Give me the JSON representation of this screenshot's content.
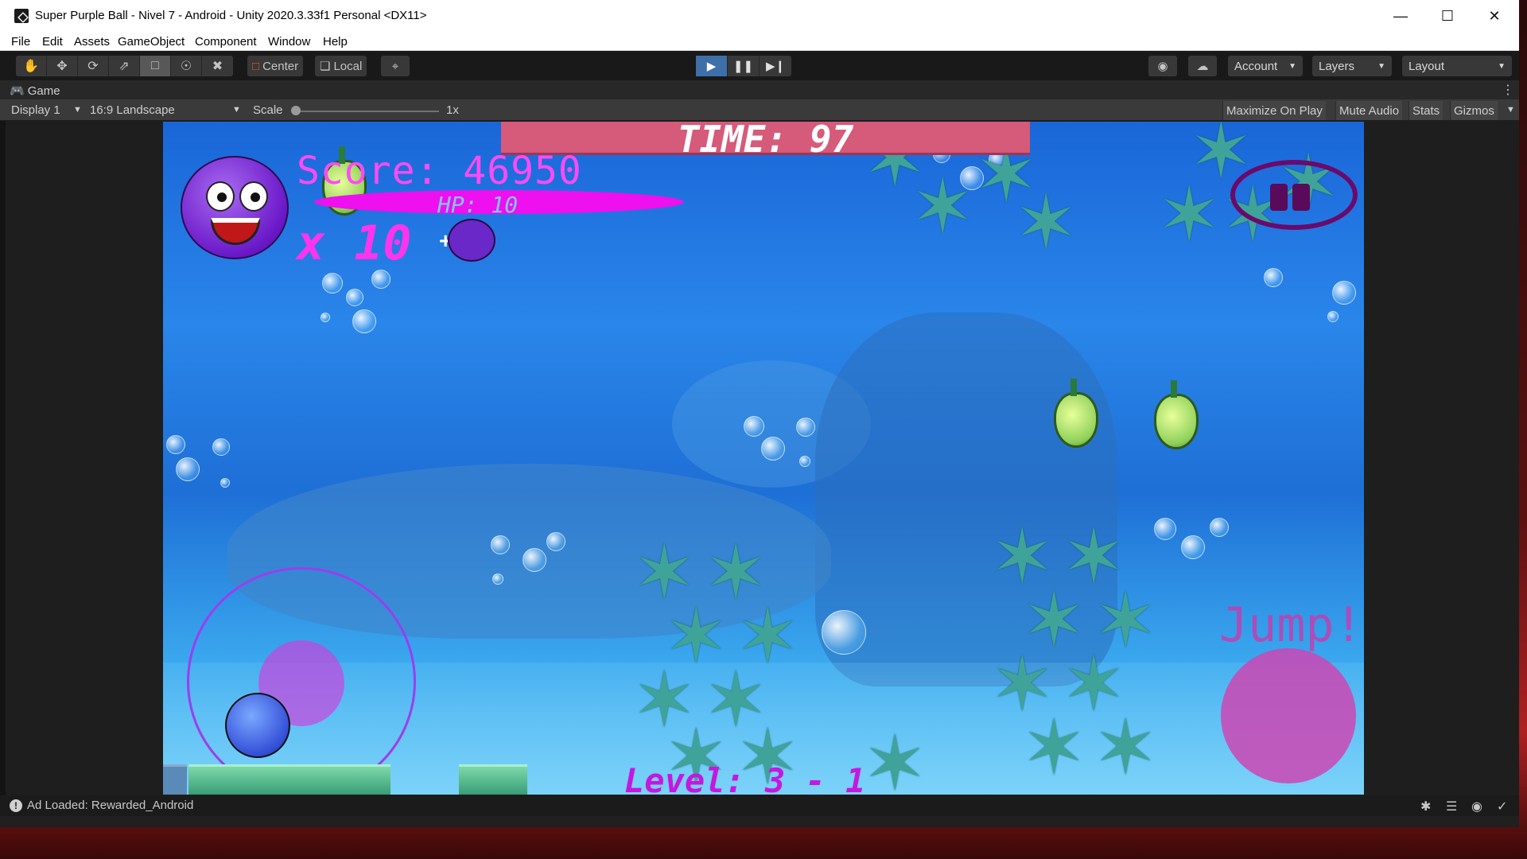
{
  "window": {
    "title": "Super Purple Ball - Nivel 7 - Android - Unity 2020.3.33f1 Personal <DX11>",
    "minimize_icon": "minimize-icon",
    "maximize_icon": "maximize-icon",
    "close_icon": "close-icon"
  },
  "menu": {
    "items": [
      "File",
      "Edit",
      "Assets",
      "GameObject",
      "Component",
      "Window",
      "Help"
    ]
  },
  "toolbar": {
    "tools": [
      "hand-icon",
      "move-icon",
      "rotate-icon",
      "scale-icon",
      "rect-tool-icon",
      "transform-icon",
      "custom-tool-icon"
    ],
    "pivot_label": "Center",
    "space_label": "Local",
    "grid_icon": "grid-snap-icon",
    "play_icon": "play-icon",
    "pause_icon": "pause-icon",
    "step_icon": "step-icon",
    "collab_icon": "collab-icon",
    "cloud_icon": "cloud-icon",
    "account_label": "Account",
    "layers_label": "Layers",
    "layout_label": "Layout"
  },
  "game_panel": {
    "tab_label": "Game",
    "display": "Display 1",
    "aspect": "16:9 Landscape",
    "scale_label": "Scale",
    "scale_value": "1x",
    "maximize_label": "Maximize On Play",
    "mute_label": "Mute Audio",
    "stats_label": "Stats",
    "gizmos_label": "Gizmos"
  },
  "game": {
    "timer": "TIME: 97",
    "score": "Score: 46950",
    "hp": "HP: 10",
    "lives": "x 10",
    "plus": "+",
    "jump": "Jump!",
    "level": "Level: 3 - 1"
  },
  "status": {
    "message": "Ad Loaded: Rewarded_Android"
  },
  "colors": {
    "unity_dark": "#202020",
    "play_active": "#3d6fa8",
    "score_magenta": "#ff4af5",
    "hp_bar": "#ee10ee",
    "timer_pink": "#d65a7a",
    "spike_teal": "#3fa39a"
  }
}
